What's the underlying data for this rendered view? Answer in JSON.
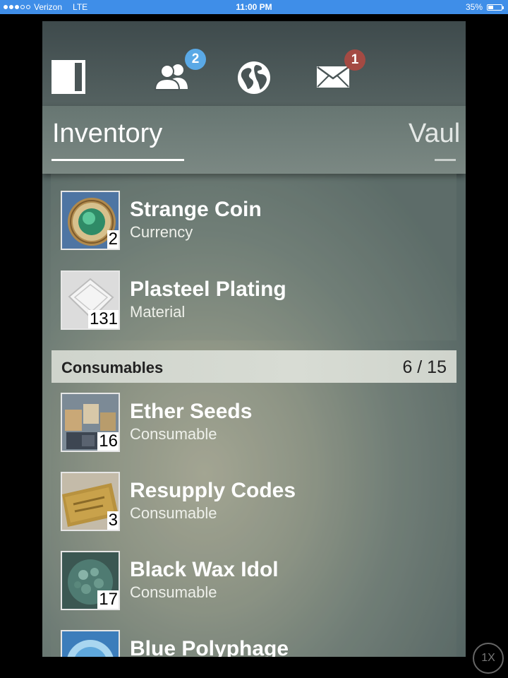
{
  "status_bar": {
    "carrier": "Verizon",
    "network": "LTE",
    "time": "11:00 PM",
    "battery": "35%",
    "signal_bars_filled": 3,
    "signal_bars_total": 5
  },
  "nav": {
    "icons": [
      "panel-toggle-icon",
      "friends-icon",
      "globe-icon",
      "mail-icon"
    ],
    "friends_badge": "2",
    "mail_badge": "1",
    "colors": {
      "friends_badge": "#5aa9e6",
      "mail_badge": "#a44a43"
    }
  },
  "tabs": [
    {
      "label": "Inventory",
      "active": true
    },
    {
      "label": "Vaul",
      "active": false
    }
  ],
  "top_items": [
    {
      "name": "Strange Coin",
      "type": "Currency",
      "count": "2",
      "icon": "strange-coin-icon"
    },
    {
      "name": "Plasteel Plating",
      "type": "Material",
      "count": "131",
      "icon": "plasteel-plating-icon"
    }
  ],
  "consumables": {
    "title": "Consumables",
    "count": "6 / 15",
    "items": [
      {
        "name": "Ether Seeds",
        "type": "Consumable",
        "count": "16",
        "icon": "ether-seeds-icon"
      },
      {
        "name": "Resupply Codes",
        "type": "Consumable",
        "count": "3",
        "icon": "resupply-codes-icon"
      },
      {
        "name": "Black Wax Idol",
        "type": "Consumable",
        "count": "17",
        "icon": "black-wax-idol-icon"
      },
      {
        "name": "Blue Polyphage",
        "type": "",
        "count": "",
        "icon": "blue-polyphage-icon"
      }
    ]
  },
  "zoom_button": "1X"
}
